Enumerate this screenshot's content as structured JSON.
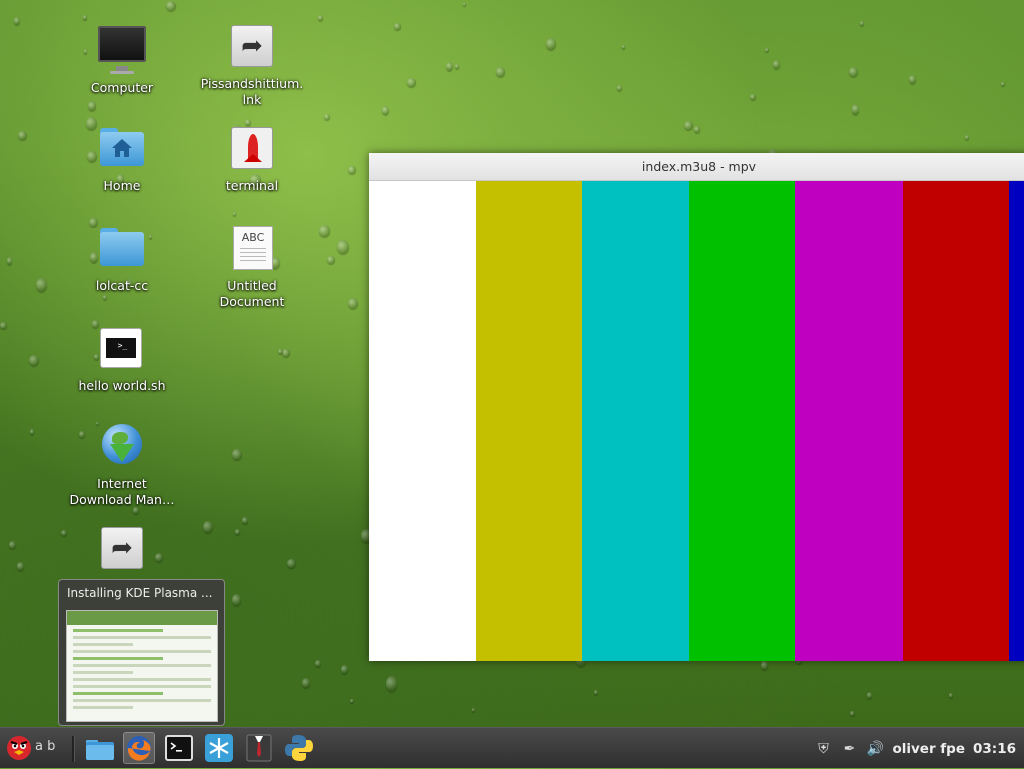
{
  "desktop": {
    "icons": [
      {
        "label": "Computer",
        "icon": "computer-icon"
      },
      {
        "label": "Pissandshittium.\nlnk",
        "icon": "shortcut-arrow-icon"
      },
      {
        "label": "Home",
        "icon": "home-folder-icon"
      },
      {
        "label": "terminal",
        "icon": "rocket-icon"
      },
      {
        "label": "lolcat-cc",
        "icon": "folder-icon"
      },
      {
        "label": "Untitled Document",
        "icon": "document-icon",
        "doc_text": "ABC"
      },
      {
        "label": "hello world.sh",
        "icon": "terminal-script-icon",
        "prompt": ">_"
      },
      {
        "label": "Internet Download Man…",
        "icon": "download-manager-icon"
      },
      {
        "label": "",
        "icon": "shortcut-arrow-icon"
      }
    ]
  },
  "mpv_window": {
    "title": "index.m3u8 - mpv",
    "color_bars": [
      "#ffffff",
      "#c4c000",
      "#00c0c0",
      "#00c000",
      "#c000c0",
      "#c00000",
      "#0000c0"
    ]
  },
  "preview": {
    "title": "Installing KDE Plasma ..."
  },
  "taskbar": {
    "menu_label": "a b",
    "apps": [
      {
        "name": "angry-birds-icon"
      },
      {
        "name": "file-manager-icon"
      },
      {
        "name": "firefox-icon",
        "active": true
      },
      {
        "name": "terminal-icon"
      },
      {
        "name": "snowflake-app-icon"
      },
      {
        "name": "suit-app-icon"
      },
      {
        "name": "python-icon"
      }
    ],
    "tray": {
      "user_text": "oliver fpe",
      "clock": "03:16"
    }
  }
}
